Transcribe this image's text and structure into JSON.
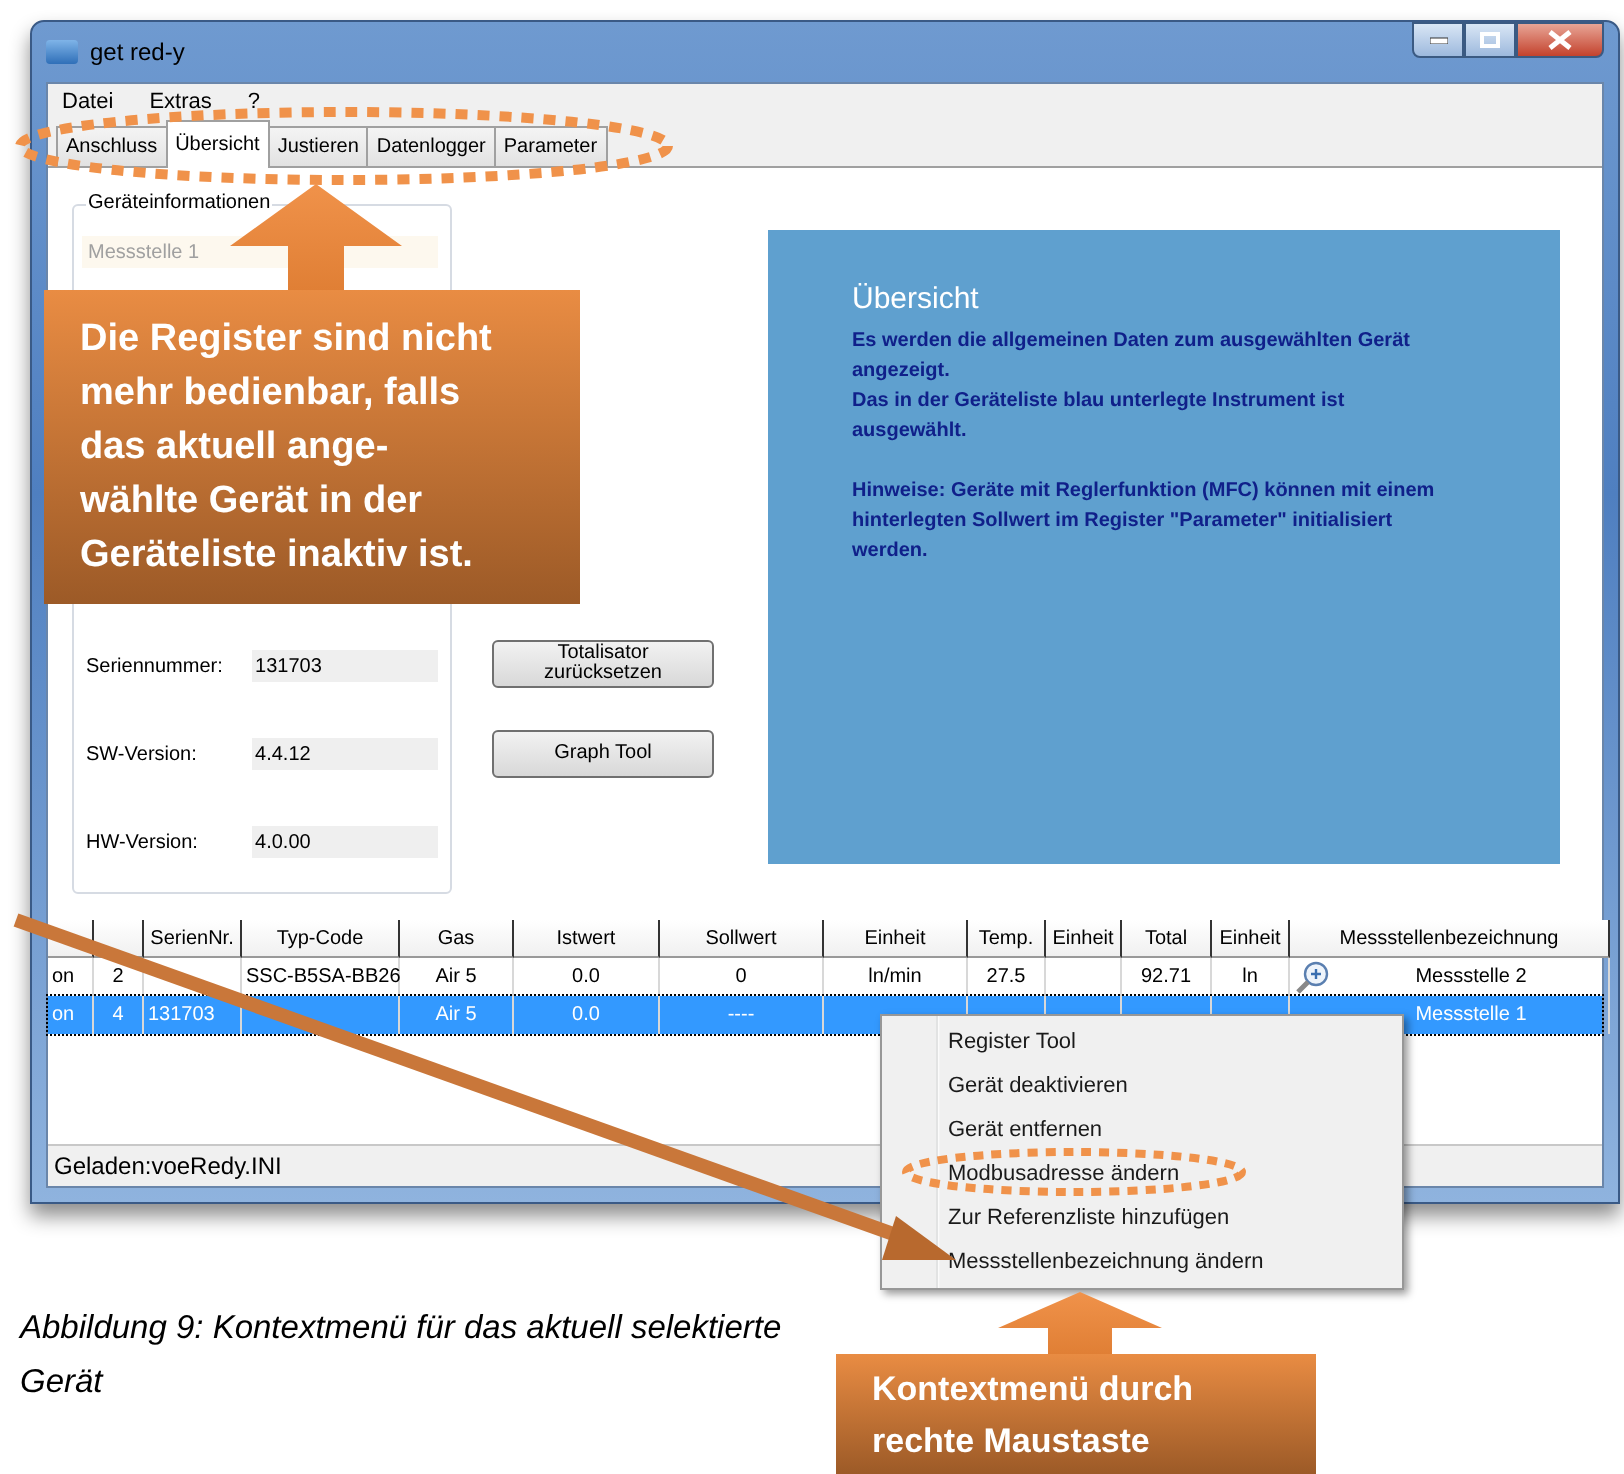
{
  "window": {
    "title": "get red-y"
  },
  "menu": [
    "Datei",
    "Extras",
    "?"
  ],
  "tabs": [
    {
      "label": "Anschluss",
      "selected": false
    },
    {
      "label": "Übersicht",
      "selected": true
    },
    {
      "label": "Justieren",
      "selected": false
    },
    {
      "label": "Datenlogger",
      "selected": false
    },
    {
      "label": "Parameter",
      "selected": false
    }
  ],
  "device_info": {
    "title": "Geräteinformationen",
    "name_field": "Messstelle 1",
    "fields": [
      {
        "label": "Seriennummer:",
        "value": "131703"
      },
      {
        "label": "SW-Version:",
        "value": "4.4.12"
      },
      {
        "label": "HW-Version:",
        "value": "4.0.00"
      }
    ]
  },
  "buttons": [
    "Totalisator zurücksetzen",
    "Graph Tool"
  ],
  "info_panel": {
    "title": "Übersicht",
    "paragraphs": [
      {
        "kind": "text",
        "text": "Es werden die allgemeinen Daten zum ausgewählten Gerät angezeigt."
      },
      {
        "kind": "text",
        "text": "Das in der Geräteliste blau unterlegte Instrument ist ausgewählt."
      },
      {
        "kind": "note",
        "text": "Hinweise: Geräte mit Reglerfunktion (MFC) können mit einem hinterlegten Sollwert im Register \"Parameter\" initialisiert werden."
      }
    ]
  },
  "device_table": {
    "columns": [
      null,
      null,
      "SerienNr.",
      "Typ-Code",
      "Gas",
      "Istwert",
      "Sollwert",
      "Einheit",
      "Temp.",
      "Einheit",
      "Total",
      "Einheit",
      "Messstellenbezeichnung"
    ],
    "rows": [
      {
        "selected": false,
        "zoom_icon": true,
        "cells": [
          "on",
          "2",
          null,
          "SSC-B5SA-BB26",
          "Air 5",
          "0.0",
          "0",
          "ln/min",
          "27.5",
          null,
          "92.71",
          "ln",
          "Messstelle 2"
        ]
      },
      {
        "selected": true,
        "zoom_icon": false,
        "cells": [
          "on",
          "4",
          "131703",
          null,
          "Air 5",
          "0.0",
          "----",
          null,
          null,
          null,
          null,
          null,
          "Messstelle 1"
        ]
      }
    ]
  },
  "status_bar": "Geladen:voeRedy.INI",
  "context_menu": [
    "Register Tool",
    "Gerät deaktivieren",
    "Gerät entfernen",
    "Modbusadresse ändern",
    "Zur Referenzliste hinzufügen",
    "Messstellenbezeichnung ändern"
  ],
  "callouts": [
    {
      "lines": [
        "Die Register sind nicht",
        "mehr bedienbar, falls",
        "das aktuell ange-",
        "wählte Gerät in der",
        "Geräteliste inaktiv ist."
      ]
    },
    {
      "lines": [
        "Kontextmenü durch",
        "rechte Maustaste"
      ]
    }
  ],
  "caption": "Abbildung 9: Kontextmenü für das aktuell selektierte Gerät"
}
